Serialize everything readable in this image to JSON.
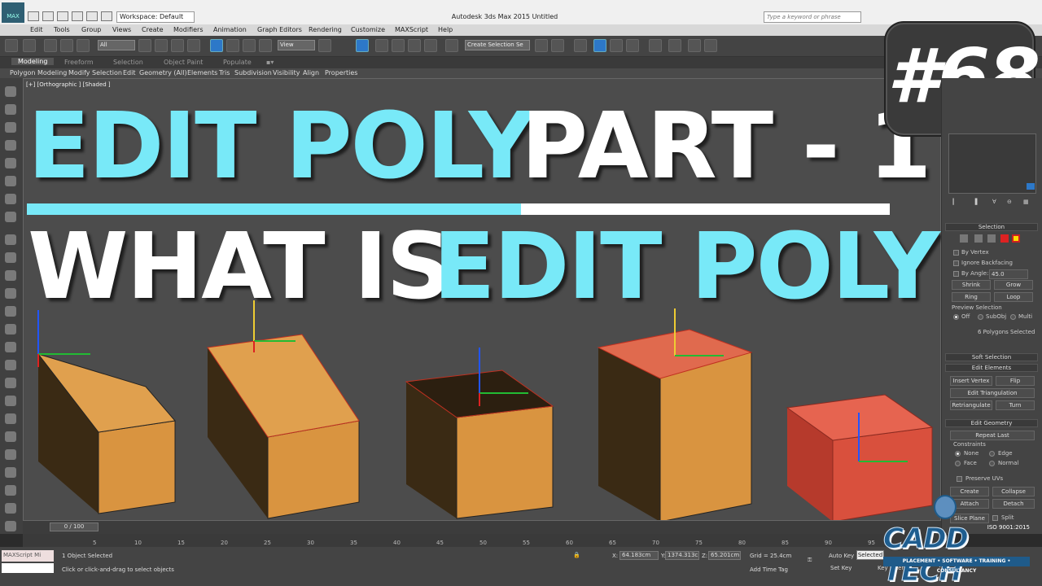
{
  "titlebar": {
    "workspace": "Workspace: Default",
    "title": "Autodesk 3ds Max  2015     Untitled",
    "search_placeholder": "Type a keyword or phrase"
  },
  "menu": [
    "Edit",
    "Tools",
    "Group",
    "Views",
    "Create",
    "Modifiers",
    "Animation",
    "Graph Editors",
    "Rendering",
    "Customize",
    "MAXScript",
    "Help"
  ],
  "toolbar": {
    "filter_all": "All",
    "view_select": "View",
    "selection_set": "Create Selection Se"
  },
  "ribbon": {
    "tabs": [
      "Modeling",
      "Freeform",
      "Selection",
      "Object Paint",
      "Populate"
    ],
    "subtabs": [
      "Polygon Modeling",
      "Modify Selection",
      "Edit",
      "Geometry (All)",
      "Elements",
      "Tris",
      "Subdivision",
      "Visibility",
      "Align",
      "Properties"
    ]
  },
  "viewport": {
    "label": "[+] [Orthographic ] [Shaded ]"
  },
  "headline": {
    "line1_part1": "EDIT POLY",
    "line1_part2": "PART - 1",
    "line2_part1": "WHAT IS",
    "line2_part2": "EDIT POLY",
    "badge": "#68"
  },
  "command_panel": {
    "selection_title": "Selection",
    "by_vertex": "By Vertex",
    "ignore_backfacing": "Ignore Backfacing",
    "by_angle": "By Angle:",
    "angle_value": "45.0",
    "shrink": "Shrink",
    "grow": "Grow",
    "ring": "Ring",
    "loop": "Loop",
    "preview_selection": "Preview Selection",
    "off": "Off",
    "subobj": "SubObj",
    "multi": "Multi",
    "selected_count": "6 Polygons Selected",
    "soft_selection": "Soft Selection",
    "edit_elements": "Edit Elements",
    "insert_vertex": "Insert Vertex",
    "flip": "Flip",
    "edit_triangulation": "Edit Triangulation",
    "retriangulate": "Retriangulate",
    "turn": "Turn",
    "edit_geometry": "Edit Geometry",
    "repeat_last": "Repeat Last",
    "constraints": "Constraints",
    "none": "None",
    "edge": "Edge",
    "face": "Face",
    "normal": "Normal",
    "preserve_uvs": "Preserve UVs",
    "create": "Create",
    "collapse": "Collapse",
    "attach": "Attach",
    "detach": "Detach",
    "slice_plane": "Slice Plane",
    "split": "Split"
  },
  "timeline": {
    "frame": "0 / 100",
    "ticks": [
      "5",
      "10",
      "15",
      "20",
      "25",
      "30",
      "35",
      "40",
      "45",
      "50",
      "55",
      "60",
      "65",
      "70",
      "75",
      "80",
      "85",
      "90",
      "95"
    ]
  },
  "status": {
    "maxscript": "MAXScript Mi",
    "selected": "1 Object Selected",
    "prompt": "Click or click-and-drag to select objects",
    "x_label": "X:",
    "x_value": "64.183cm",
    "y_label": "Y:",
    "y_value": "1374.313c",
    "z_label": "Z:",
    "z_value": "65.201cm",
    "grid": "Grid = 25.4cm",
    "add_time_tag": "Add Time Tag",
    "auto_key": "Auto Key",
    "set_key": "Set Key",
    "selected_dropdown": "Selected",
    "key_filters": "Key Filters..."
  },
  "logo": {
    "name": "CADD TECH",
    "iso": "ISO 9001:2015",
    "tagline": "PLACEMENT • SOFTWARE • TRAINING • CONSULTANCY"
  },
  "colors": {
    "cyan": "#78e9f8",
    "box_orange": "#d99440",
    "box_selected_red": "#d9503d",
    "viewport_bg": "#4c4c4c"
  }
}
